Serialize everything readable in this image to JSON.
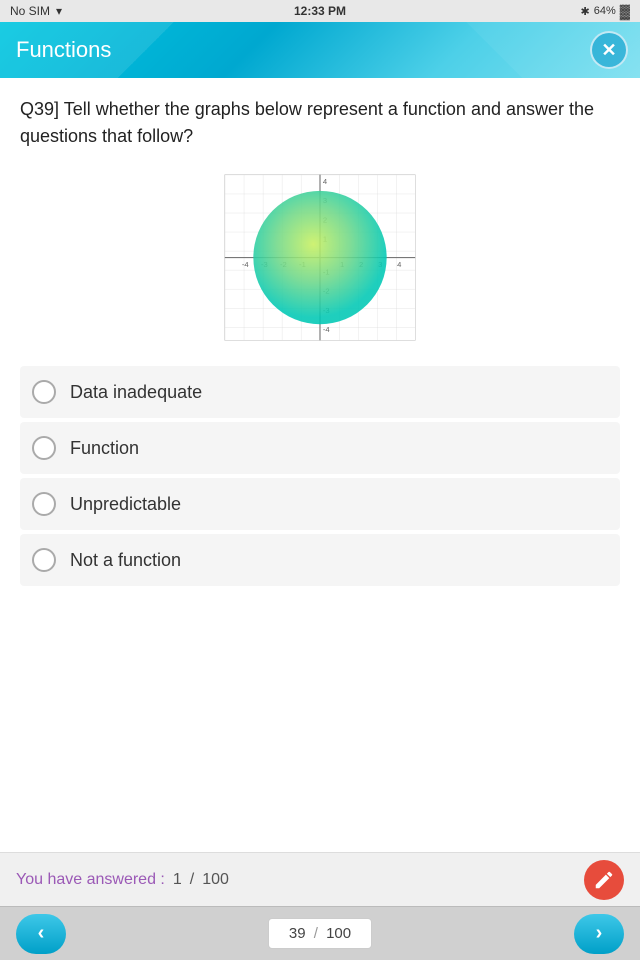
{
  "statusBar": {
    "carrier": "No SIM",
    "wifi": "◀",
    "time": "12:33 PM",
    "bluetooth": "✱",
    "battery": "64%"
  },
  "header": {
    "title": "Functions",
    "closeBtn": "✕"
  },
  "question": {
    "number": "Q39]",
    "text": "   Tell whether the graphs below represent a function and answer the questions that follow?"
  },
  "options": [
    {
      "id": 1,
      "label": "Data inadequate"
    },
    {
      "id": 2,
      "label": "Function"
    },
    {
      "id": 3,
      "label": "Unpredictable"
    },
    {
      "id": 4,
      "label": "Not a function"
    }
  ],
  "answeredBar": {
    "label": "You have answered :",
    "current": "1",
    "slash": "/",
    "total": "100"
  },
  "navBar": {
    "prevBtn": "‹",
    "nextBtn": "›",
    "currentPage": "39",
    "slash": "/",
    "totalPages": "100"
  }
}
